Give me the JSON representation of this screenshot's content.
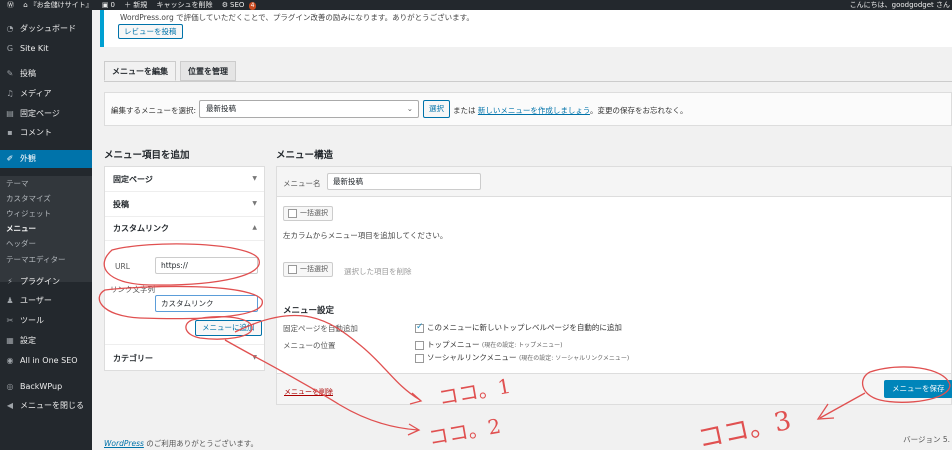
{
  "adminbar": {
    "site": "『お金儲けサイト』",
    "comments": "0",
    "new": "新規",
    "cache": "キャッシュを削除",
    "seo": "SEO",
    "seo_badge": "4",
    "greeting": "こんにちは、goodgodget さん"
  },
  "sidebar": {
    "items": [
      {
        "label": "ダッシュボード"
      },
      {
        "label": "Site Kit"
      },
      {
        "label": "投稿"
      },
      {
        "label": "メディア"
      },
      {
        "label": "固定ページ"
      },
      {
        "label": "コメント"
      },
      {
        "label": "外観"
      },
      {
        "label": "プラグイン"
      },
      {
        "label": "ユーザー"
      },
      {
        "label": "ツール"
      },
      {
        "label": "設定"
      },
      {
        "label": "All in One SEO"
      },
      {
        "label": "BackWPup"
      },
      {
        "label": "メニューを閉じる"
      }
    ],
    "submenu": [
      "テーマ",
      "カスタマイズ",
      "ウィジェット",
      "メニュー",
      "ヘッダー",
      "テーマエディター"
    ]
  },
  "notice": {
    "text": "WordPress.org で評価していただくことで、プラグイン改善の励みになります。ありがとうございます。",
    "button": "レビューを投稿"
  },
  "tabs": [
    "メニューを編集",
    "位置を管理"
  ],
  "select_bar": {
    "label": "編集するメニューを選択:",
    "value": "最新投稿",
    "button": "選択",
    "or": "または",
    "link": "新しいメニューを作成しましょう",
    "after": "。変更の保存をお忘れなく。"
  },
  "add_items": {
    "heading": "メニュー項目を追加",
    "panels": [
      "固定ページ",
      "投稿",
      "カスタムリンク",
      "カテゴリー"
    ],
    "url_label": "URL",
    "url_value": "https://",
    "link_text_label": "リンク文字列",
    "link_text_value": "カスタムリンク",
    "add_button": "メニューに追加"
  },
  "structure": {
    "heading": "メニュー構造",
    "name_label": "メニュー名",
    "name_value": "最新投稿",
    "bulk_select": "一括選択",
    "instruction": "左カラムからメニュー項目を追加してください。",
    "remove_selected": "選択した項目を削除",
    "settings_heading": "メニュー設定",
    "auto_add_label": "固定ページを自動追加",
    "auto_add_option": "このメニューに新しいトップレベルページを自動的に追加",
    "location_label": "メニューの位置",
    "loc1": "トップメニュー",
    "loc1_note": "(現在の設定: トップメニュー)",
    "loc2": "ソーシャルリンクメニュー",
    "loc2_note": "(現在の設定: ソーシャルリンクメニュー)",
    "delete_link": "メニューを削除",
    "save_button": "メニューを保存"
  },
  "footer": {
    "wp": "WordPress",
    "thanks": " のご利用ありがとうございます。",
    "version": "バージョン 5."
  },
  "annotations": [
    "ココ。1",
    "ココ。2",
    "ココ。3"
  ],
  "colors": {
    "admin_dark": "#23282d",
    "accent": "#0073aa",
    "save": "#0085ba",
    "annotation": "#e05050"
  }
}
